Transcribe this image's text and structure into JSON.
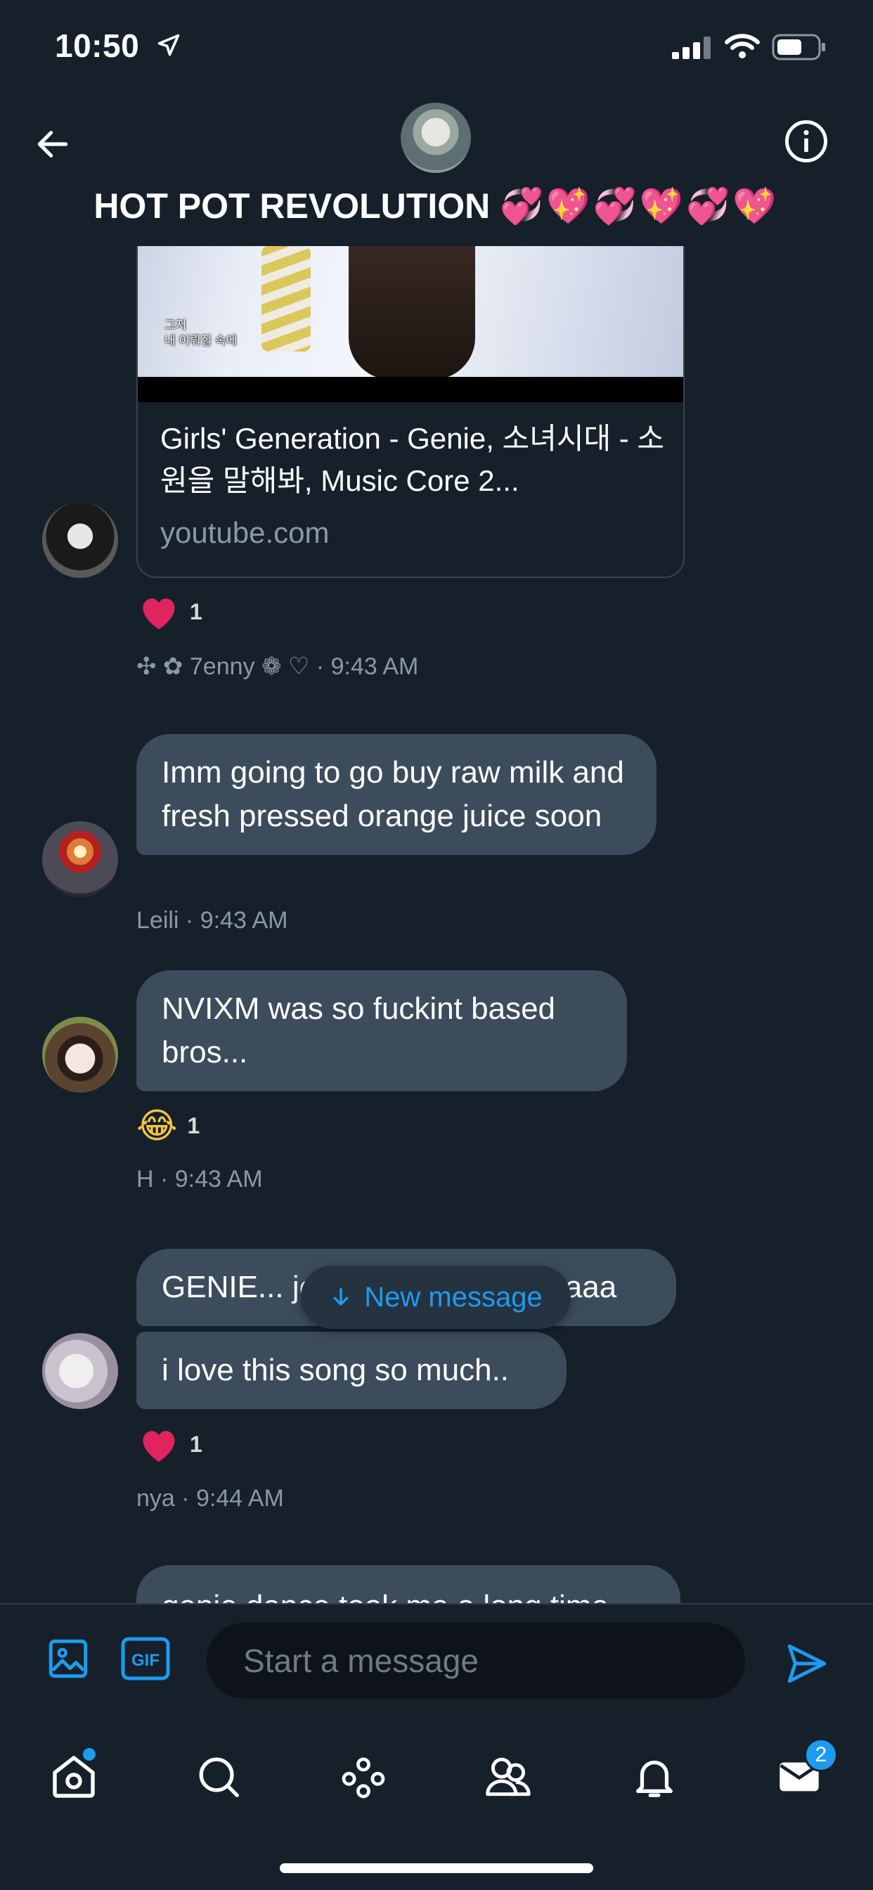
{
  "status_bar": {
    "time": "10:50"
  },
  "header": {
    "title": "HOT POT REVOLUTION",
    "title_emojis": "💞💖💞💖💞💖"
  },
  "link_card": {
    "thumb_caption_line1": "그저",
    "thumb_caption_line2": "내 이뤄질 속에",
    "title": "Girls' Generation - Genie, 소녀시대 - 소원을 말해봐, Music Core 2...",
    "domain": "youtube.com"
  },
  "messages": [
    {
      "sender": "✣ ✿ 7enny ❁ ♡",
      "time": "9:43 AM",
      "meta": "✣ ✿ 7enny ❁ ♡ · 9:43 AM",
      "reaction": {
        "emoji": "heart",
        "count": "1"
      }
    },
    {
      "sender": "Leili",
      "text": "Imm going to go buy raw milk and fresh pressed orange juice soon",
      "meta": "Leili · 9:43 AM"
    },
    {
      "sender": "H",
      "text": "NVIXM was so fuckint based bros...",
      "meta": "H · 9:43 AM",
      "reaction": {
        "emoji": "😂",
        "count": "1"
      }
    },
    {
      "sender": "nya",
      "text1": "GENIE... jenny... JENNIE... waaa",
      "text2": "i love this song so much..",
      "meta": "nya · 9:44 AM",
      "reaction": {
        "emoji": "heart",
        "count": "1"
      }
    },
    {
      "text": "genie dance took me a long time"
    }
  ],
  "new_message_label": "New message",
  "composer": {
    "placeholder": "Start a message",
    "gif_label": "GIF"
  },
  "tabbar": {
    "messages_badge": "2"
  },
  "colors": {
    "background": "#15202b",
    "bubble": "#3d4c5c",
    "accent": "#1d9bf0",
    "muted_text": "#8b98a5",
    "heart": "#e0245e"
  }
}
